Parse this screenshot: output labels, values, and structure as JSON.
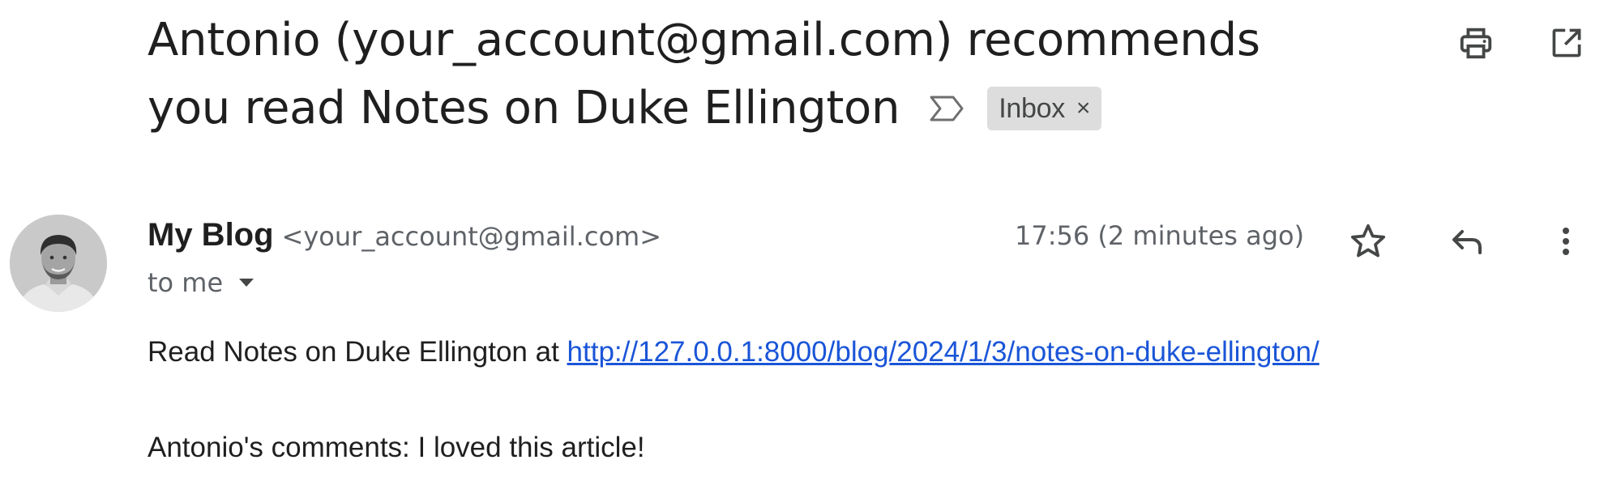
{
  "email": {
    "subject_line1": "Antonio (your_account@gmail.com) recommends",
    "subject_line2": "you read Notes on Duke Ellington",
    "label": "Inbox",
    "label_close": "×",
    "sender": {
      "name": "My Blog",
      "email": "<your_account@gmail.com>"
    },
    "recipient": "to me",
    "timestamp": "17:56 (2 minutes ago)",
    "body": {
      "line1_prefix": "Read Notes on Duke Ellington at ",
      "link": "http://127.0.0.1:8000/blog/2024/1/3/notes-on-duke-ellington/",
      "line2": "Antonio's comments: I loved this article!"
    }
  },
  "icons": {
    "importance": "importance-marker-icon",
    "print": "print-icon",
    "popout": "open-in-new-window-icon",
    "star": "star-icon",
    "reply": "reply-icon",
    "more": "more-vert-icon",
    "dropdown": "arrow-drop-down-icon"
  },
  "colors": {
    "link": "#1a55d8",
    "label_bg": "#dddddd",
    "secondary_text": "#5f6368",
    "primary_text": "#1f1f1f"
  }
}
